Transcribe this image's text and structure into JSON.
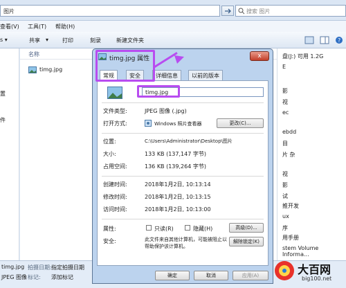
{
  "explorer": {
    "address_path": "图片",
    "search_placeholder": "搜索 图片",
    "menu": [
      "查看(V)",
      "工具(T)",
      "帮助(H)"
    ],
    "toolbar": [
      "共享",
      "打印",
      "刻录",
      "新建文件夹"
    ],
    "column_name": "名称",
    "file": "timg.jpg",
    "left_fragments": [
      "置",
      "件"
    ],
    "right_pane": [
      "盘(J:) 可用 1.2G",
      "E",
      "影",
      "视",
      "ec",
      "ebdd",
      "目",
      "片 杂",
      "视",
      "影",
      "试",
      "推开发",
      "ux",
      "序",
      "用手册",
      "stem Volume Informa..."
    ],
    "status": {
      "filename": "timg.jpg",
      "type": "JPEG 图像",
      "date_label": "拍摄日期:",
      "date_value": "指定拍摄日期",
      "tags_label": "标记:",
      "tags_value": "添加标记",
      "col1": "拍摄日期",
      "col2": "标记"
    }
  },
  "dialog": {
    "title": "timg.jpg 属性",
    "close": "x",
    "tabs": [
      "常规",
      "安全",
      "详细信息",
      "以前的版本"
    ],
    "filename": "timg.jpg",
    "type_label": "文件类型:",
    "type_value": "JPEG 图像 (.jpg)",
    "open_label": "打开方式:",
    "open_value": "Windows 照片查看器",
    "change_button": "更改(C)...",
    "location_label": "位置:",
    "location_value": "C:\\Users\\Administrator\\Desktop\\图片",
    "size_label": "大小:",
    "size_value": "133 KB (137,147 字节)",
    "disksize_label": "占用空间:",
    "disksize_value": "136 KB (139,264 字节)",
    "created_label": "创建时间:",
    "created_value": "2018年1月2日, 10:13:14",
    "modified_label": "修改时间:",
    "modified_value": "2018年1月2日, 10:13:15",
    "accessed_label": "访问时间:",
    "accessed_value": "2018年1月2日, 10:13:00",
    "attr_label": "属性:",
    "readonly": "只读(R)",
    "hidden": "隐藏(H)",
    "advanced_button": "高级(D)...",
    "security_label": "安全:",
    "security_text": "此文件来自其他计算机，可能被阻止以帮助保护该计算机。",
    "unblock_button": "解除锁定(K)",
    "ok": "确定",
    "cancel": "取消",
    "apply": "应用(A)"
  },
  "watermark": {
    "brand": "大百网",
    "url": "big100.net"
  },
  "colors": {
    "highlight": "#b84cf0",
    "titlebar": "#bcd3ee",
    "close": "#c33f2a"
  }
}
